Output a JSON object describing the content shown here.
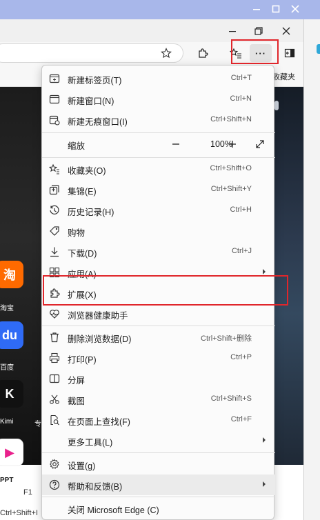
{
  "outer_window": {
    "controls": [
      "minimize",
      "maximize",
      "close"
    ]
  },
  "browser": {
    "favorites_bar_text": "收藏夹",
    "toolbar": {
      "more_label": "···"
    }
  },
  "page": {
    "apps": [
      {
        "name": "淘宝",
        "icon_text": "淘",
        "color": "#ff6a00"
      },
      {
        "name": "百度",
        "icon_text": "du",
        "color": "#2f6bf6"
      },
      {
        "name": "Kimi",
        "icon_text": "K",
        "color": "#111111"
      },
      {
        "name": "PPT",
        "icon_text": "▶",
        "color": "#e9218c"
      }
    ],
    "side_label": "专",
    "shortcuts_left": [
      "F1",
      "Ctrl+Shift+I"
    ]
  },
  "menu": {
    "items": [
      {
        "id": "new-tab",
        "label": "新建标签页(T)",
        "shortcut": "Ctrl+T",
        "icon": "new-tab-icon"
      },
      {
        "id": "new-window",
        "label": "新建窗口(N)",
        "shortcut": "Ctrl+N",
        "icon": "new-window-icon"
      },
      {
        "id": "inprivate",
        "label": "新建无痕窗口(I)",
        "shortcut": "Ctrl+Shift+N",
        "icon": "inprivate-icon"
      },
      {
        "id": "favorites",
        "label": "收藏夹(O)",
        "shortcut": "Ctrl+Shift+O",
        "icon": "favorites-icon"
      },
      {
        "id": "collections",
        "label": "集锦(E)",
        "shortcut": "Ctrl+Shift+Y",
        "icon": "collections-icon"
      },
      {
        "id": "history",
        "label": "历史记录(H)",
        "shortcut": "Ctrl+H",
        "icon": "history-icon"
      },
      {
        "id": "shopping",
        "label": "购物",
        "shortcut": "",
        "icon": "shopping-tag-icon"
      },
      {
        "id": "downloads",
        "label": "下载(D)",
        "shortcut": "Ctrl+J",
        "icon": "download-icon"
      },
      {
        "id": "apps",
        "label": "应用(A)",
        "shortcut": "",
        "icon": "apps-icon"
      },
      {
        "id": "extensions",
        "label": "扩展(X)",
        "shortcut": "",
        "icon": "extensions-puzzle-icon"
      },
      {
        "id": "health",
        "label": "浏览器健康助手",
        "shortcut": "",
        "icon": "heart-pulse-icon"
      },
      {
        "id": "clear-data",
        "label": "删除浏览数据(D)",
        "shortcut": "Ctrl+Shift+删除",
        "icon": "trash-icon"
      },
      {
        "id": "print",
        "label": "打印(P)",
        "shortcut": "Ctrl+P",
        "icon": "printer-icon"
      },
      {
        "id": "split",
        "label": "分屏",
        "shortcut": "",
        "icon": "split-screen-icon"
      },
      {
        "id": "screenshot",
        "label": "截图",
        "shortcut": "Ctrl+Shift+S",
        "icon": "scissors-icon"
      },
      {
        "id": "find",
        "label": "在页面上查找(F)",
        "shortcut": "Ctrl+F",
        "icon": "find-icon"
      },
      {
        "id": "more-tools",
        "label": "更多工具(L)",
        "shortcut": "",
        "icon": ""
      },
      {
        "id": "settings",
        "label": "设置(g)",
        "shortcut": "",
        "icon": "gear-icon"
      },
      {
        "id": "help",
        "label": "帮助和反馈(B)",
        "shortcut": "",
        "icon": "help-icon"
      },
      {
        "id": "close",
        "label": "关闭 Microsoft Edge (C)",
        "shortcut": "",
        "icon": ""
      }
    ],
    "zoom": {
      "label": "缩放",
      "value": "100%"
    }
  }
}
